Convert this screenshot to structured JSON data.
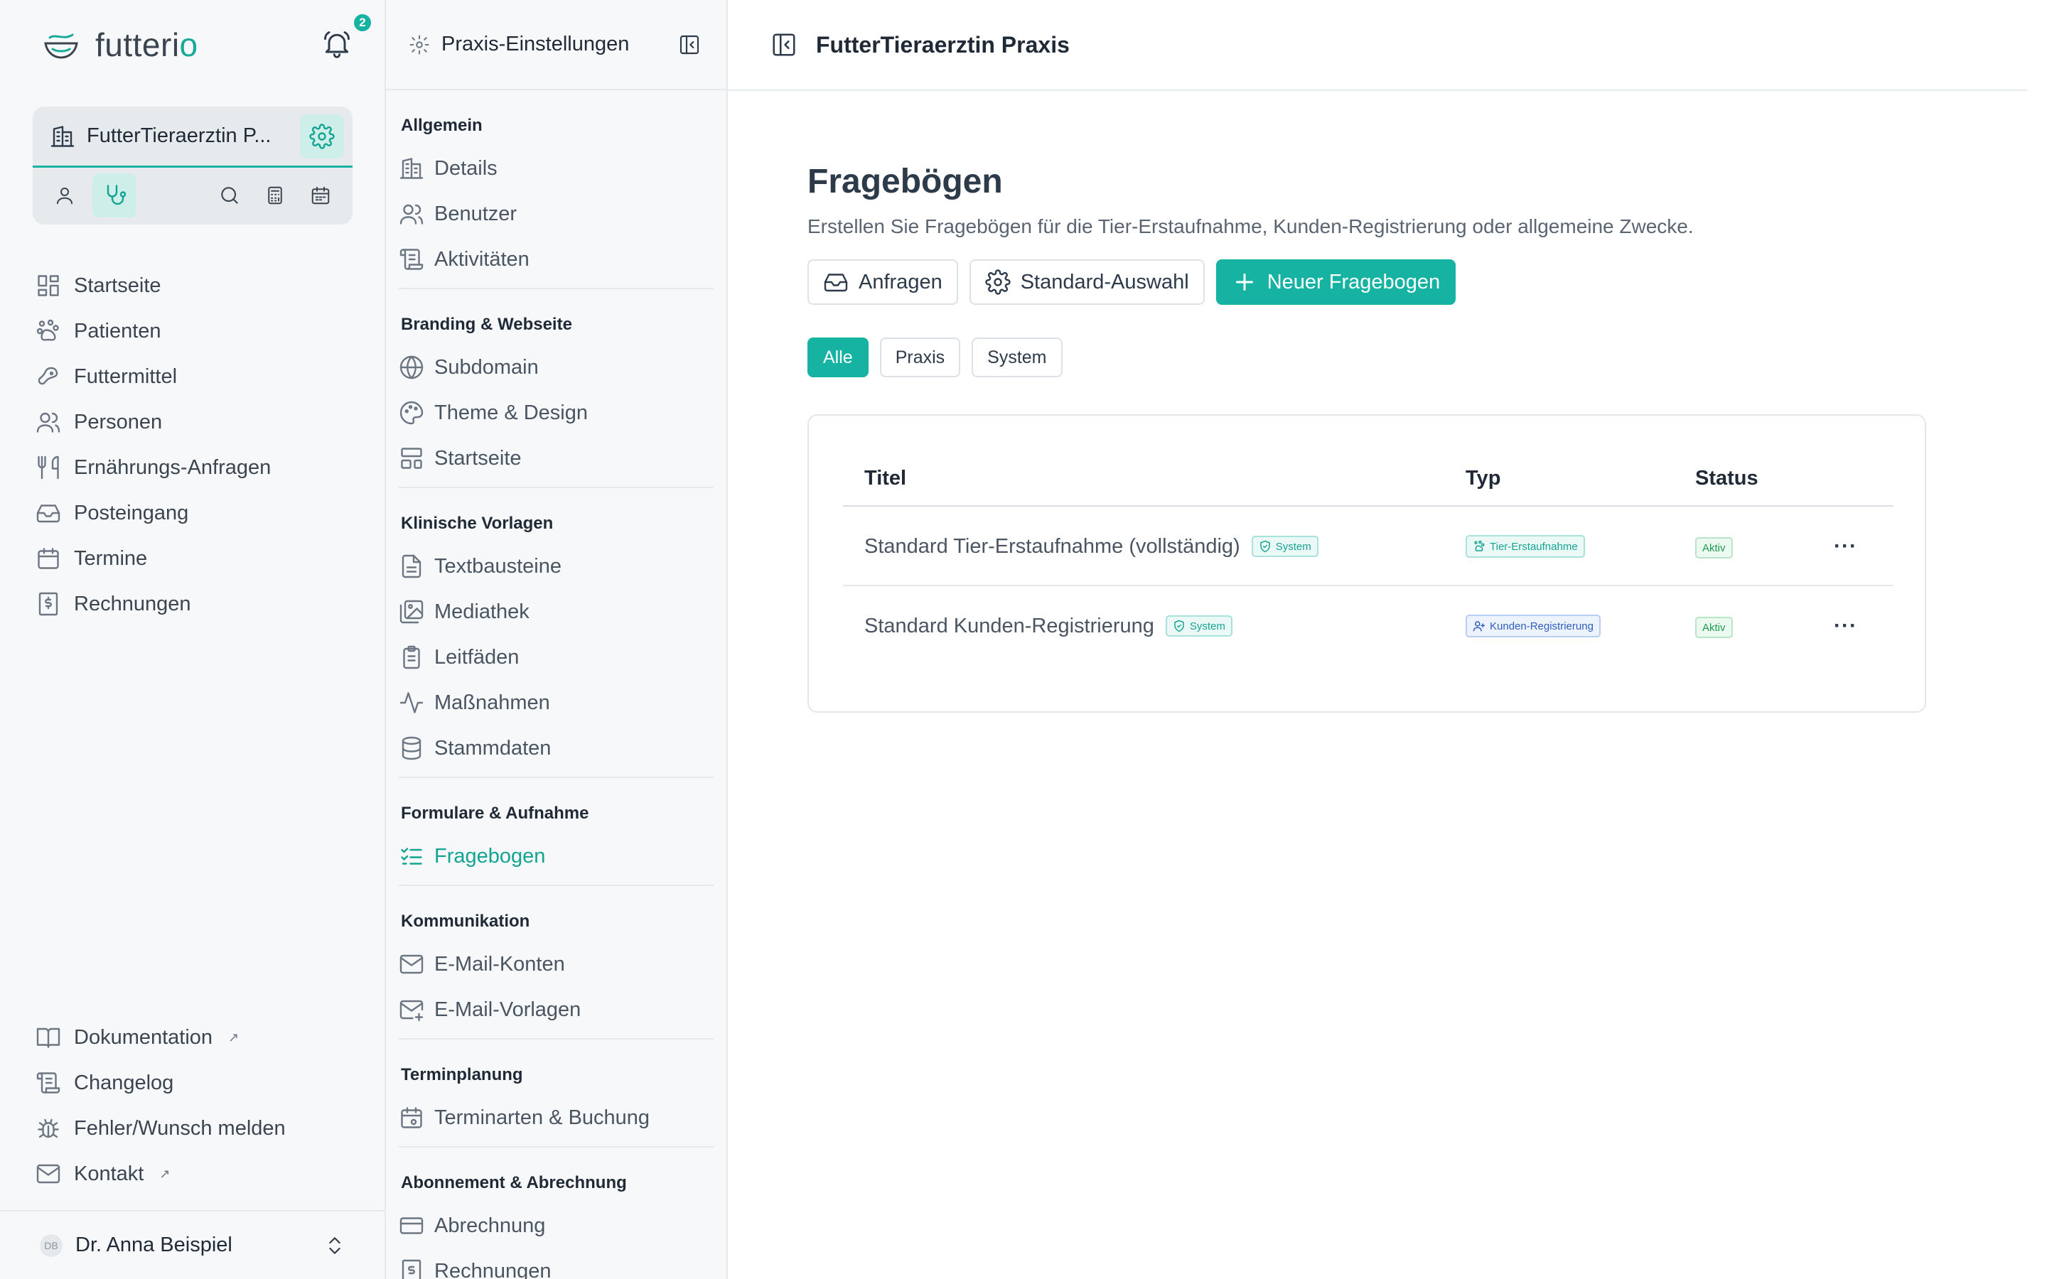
{
  "colors": {
    "accent": "#16b3a3",
    "accent_soft": "#cdeee9",
    "sidebar_bg": "#f7f8f9",
    "text": "#2d3a4a"
  },
  "brand": {
    "name_prefix": "futteri",
    "name_suffix": "o"
  },
  "notifications": {
    "count": "2",
    "icon": "bell-icon"
  },
  "practice": {
    "name": "FutterTieraerztin P..."
  },
  "sidebar": {
    "items": [
      {
        "label": "Startseite",
        "icon": "dashboard-icon"
      },
      {
        "label": "Patienten",
        "icon": "paw-icon"
      },
      {
        "label": "Futtermittel",
        "icon": "food-icon"
      },
      {
        "label": "Personen",
        "icon": "users-icon"
      },
      {
        "label": "Ernährungs-Anfragen",
        "icon": "utensils-icon"
      },
      {
        "label": "Posteingang",
        "icon": "inbox-icon"
      },
      {
        "label": "Termine",
        "icon": "calendar-icon"
      },
      {
        "label": "Rechnungen",
        "icon": "invoice-icon"
      }
    ],
    "bottom_items": [
      {
        "label": "Dokumentation",
        "icon": "book-icon",
        "external": true
      },
      {
        "label": "Changelog",
        "icon": "scroll-icon"
      },
      {
        "label": "Fehler/Wunsch melden",
        "icon": "bug-icon"
      },
      {
        "label": "Kontakt",
        "icon": "mail-icon",
        "external": true
      }
    ],
    "external_mark": "↗"
  },
  "user": {
    "initials": "DB",
    "name": "Dr. Anna Beispiel"
  },
  "settings": {
    "title": "Praxis-Einstellungen",
    "sections": [
      {
        "title": "Allgemein",
        "items": [
          "Details",
          "Benutzer",
          "Aktivitäten"
        ]
      },
      {
        "title": "Branding & Webseite",
        "items": [
          "Subdomain",
          "Theme & Design",
          "Startseite"
        ]
      },
      {
        "title": "Klinische Vorlagen",
        "items": [
          "Textbausteine",
          "Mediathek",
          "Leitfäden",
          "Maßnahmen",
          "Stammdaten"
        ]
      },
      {
        "title": "Formulare & Aufnahme",
        "items": [
          "Fragebogen"
        ]
      },
      {
        "title": "Kommunikation",
        "items": [
          "E-Mail-Konten",
          "E-Mail-Vorlagen"
        ]
      },
      {
        "title": "Terminplanung",
        "items": [
          "Terminarten & Buchung"
        ]
      },
      {
        "title": "Abonnement & Abrechnung",
        "items": [
          "Abrechnung",
          "Rechnungen"
        ]
      }
    ]
  },
  "main": {
    "header_title": "FutterTieraerztin Praxis",
    "page_title": "Fragebögen",
    "subtitle": "Erstellen Sie Fragebögen für die Tier-Erstaufnahme, Kunden-Registrierung oder allgemeine Zwecke.",
    "buttons": {
      "requests": "Anfragen",
      "default_selection": "Standard-Auswahl",
      "new": "Neuer Fragebogen"
    },
    "filters": [
      "Alle",
      "Praxis",
      "System"
    ],
    "active_filter": "Alle",
    "table": {
      "columns": [
        "Titel",
        "Typ",
        "Status"
      ],
      "rows": [
        {
          "title": "Standard Tier-Erstaufnahme (vollständig)",
          "badge": "System",
          "type": "Tier-Erstaufnahme",
          "status": "Aktiv"
        },
        {
          "title": "Standard Kunden-Registrierung",
          "badge": "System",
          "type": "Kunden-Registrierung",
          "status": "Aktiv"
        }
      ],
      "row_menu": "···"
    }
  }
}
